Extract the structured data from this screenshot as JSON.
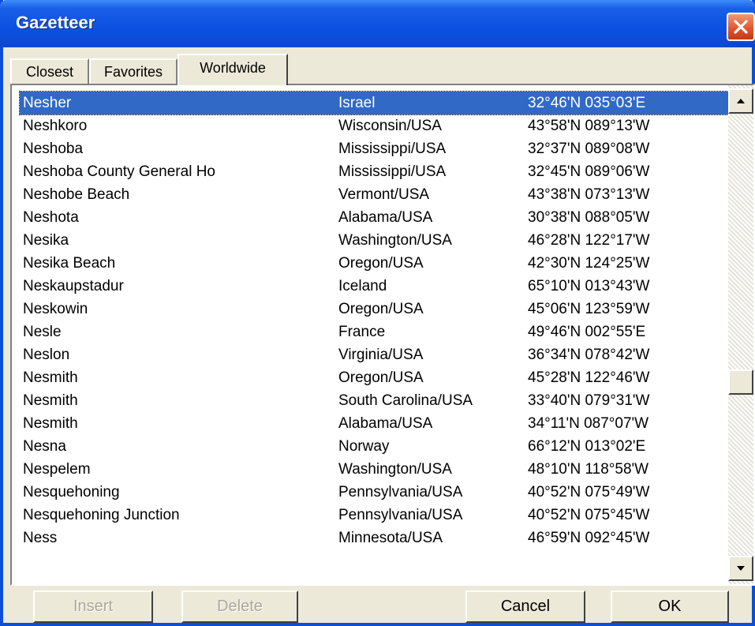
{
  "window": {
    "title": "Gazetteer"
  },
  "tabs": [
    {
      "label": "Closest",
      "active": false
    },
    {
      "label": "Favorites",
      "active": false
    },
    {
      "label": "Worldwide",
      "active": true
    }
  ],
  "list": {
    "rows": [
      {
        "name": "Nesher",
        "region": "Israel",
        "coord": "32°46'N 035°03'E",
        "selected": true
      },
      {
        "name": "Neshkoro",
        "region": "Wisconsin/USA",
        "coord": "43°58'N 089°13'W"
      },
      {
        "name": "Neshoba",
        "region": "Mississippi/USA",
        "coord": "32°37'N 089°08'W"
      },
      {
        "name": "Neshoba County General Ho",
        "region": "Mississippi/USA",
        "coord": "32°45'N 089°06'W"
      },
      {
        "name": "Neshobe Beach",
        "region": "Vermont/USA",
        "coord": "43°38'N 073°13'W"
      },
      {
        "name": "Neshota",
        "region": "Alabama/USA",
        "coord": "30°38'N 088°05'W"
      },
      {
        "name": "Nesika",
        "region": "Washington/USA",
        "coord": "46°28'N 122°17'W"
      },
      {
        "name": "Nesika Beach",
        "region": "Oregon/USA",
        "coord": "42°30'N 124°25'W"
      },
      {
        "name": "Neskaupstadur",
        "region": "Iceland",
        "coord": "65°10'N 013°43'W"
      },
      {
        "name": "Neskowin",
        "region": "Oregon/USA",
        "coord": "45°06'N 123°59'W"
      },
      {
        "name": "Nesle",
        "region": "France",
        "coord": "49°46'N 002°55'E"
      },
      {
        "name": "Neslon",
        "region": "Virginia/USA",
        "coord": "36°34'N 078°42'W"
      },
      {
        "name": "Nesmith",
        "region": "Oregon/USA",
        "coord": "45°28'N 122°46'W"
      },
      {
        "name": "Nesmith",
        "region": "South Carolina/USA",
        "coord": "33°40'N 079°31'W"
      },
      {
        "name": "Nesmith",
        "region": "Alabama/USA",
        "coord": "34°11'N 087°07'W"
      },
      {
        "name": "Nesna",
        "region": "Norway",
        "coord": "66°12'N 013°02'E"
      },
      {
        "name": "Nespelem",
        "region": "Washington/USA",
        "coord": "48°10'N 118°58'W"
      },
      {
        "name": "Nesquehoning",
        "region": "Pennsylvania/USA",
        "coord": "40°52'N 075°49'W"
      },
      {
        "name": "Nesquehoning Junction",
        "region": "Pennsylvania/USA",
        "coord": "40°52'N 075°45'W"
      },
      {
        "name": "Ness",
        "region": "Minnesota/USA",
        "coord": "46°59'N 092°45'W"
      }
    ]
  },
  "buttons": {
    "insert": {
      "label": "Insert",
      "enabled": false
    },
    "delete": {
      "label": "Delete",
      "enabled": false
    },
    "cancel": {
      "label": "Cancel",
      "enabled": true
    },
    "ok": {
      "label": "OK",
      "enabled": true
    }
  },
  "icons": {
    "close": "close-icon",
    "scroll_up": "scroll-up-arrow-icon",
    "scroll_down": "scroll-down-arrow-icon"
  },
  "colors": {
    "titlebar": "#0a47d1",
    "selection": "#3169c6",
    "close_button": "#e0522a",
    "face": "#ece9d8"
  }
}
